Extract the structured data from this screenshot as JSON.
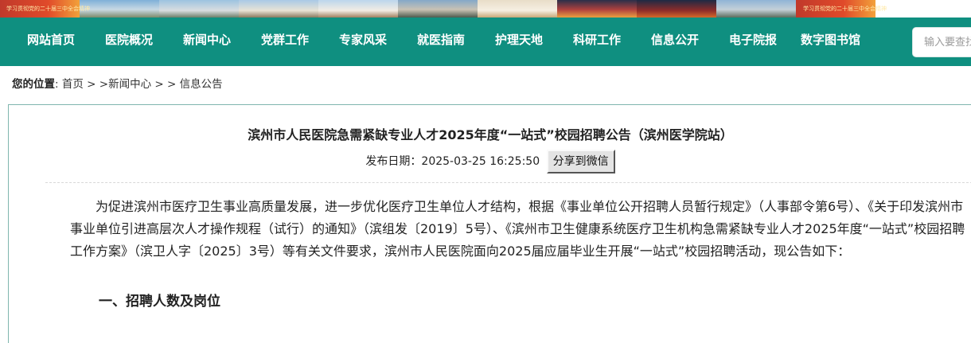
{
  "banner": {
    "slogan_left": "学习贯彻党的二十届三中全会精神",
    "slogan_right": "学习贯彻党的二十届三中全会精神"
  },
  "nav": {
    "items": [
      {
        "label": "网站首页"
      },
      {
        "label": "医院概况"
      },
      {
        "label": "新闻中心"
      },
      {
        "label": "党群工作"
      },
      {
        "label": "专家风采"
      },
      {
        "label": "就医指南"
      },
      {
        "label": "护理天地"
      },
      {
        "label": "科研工作"
      },
      {
        "label": "信息公开"
      },
      {
        "label": "电子院报"
      },
      {
        "label": "数字图书馆"
      }
    ],
    "search_placeholder": "输入要查找的内容",
    "bar_color": "#0f8f80"
  },
  "breadcrumb": {
    "label": "您的位置",
    "colon": ":",
    "home": "首页",
    "sep1": " > >",
    "news": "新闻中心",
    "sep2": " > >",
    "current": "信息公告"
  },
  "article": {
    "title": "滨州市人民医院急需紧缺专业人才2025年度“一站式”校园招聘公告（滨州医学院站）",
    "date_label": "发布日期：",
    "date_value": "2025-03-25 16:25:50",
    "share_label": "分享到微信",
    "paragraph": "为促进滨州市医疗卫生事业高质量发展，进一步优化医疗卫生单位人才结构，根据《事业单位公开招聘人员暂行规定》（人事部令第6号）、《关于印发滨州市事业单位引进高层次人才操作规程（试行）的通知》（滨组发〔2019〕5号）、《滨州市卫生健康系统医疗卫生机构急需紧缺专业人才2025年度“一站式”校园招聘工作方案》（滨卫人字〔2025〕3号）等有关文件要求，滨州市人民医院面向2025届应届毕业生开展“一站式”校园招聘活动，现公告如下：",
    "section1": "一、招聘人数及岗位"
  }
}
